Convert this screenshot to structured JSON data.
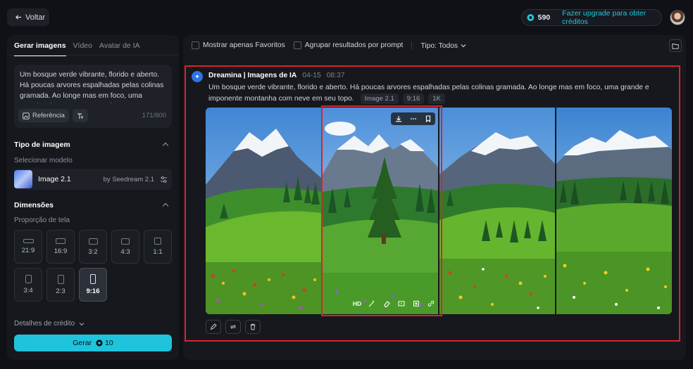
{
  "topbar": {
    "back_label": "Voltar",
    "credits": "590",
    "upgrade_label": "Fazer upgrade para obter créditos"
  },
  "left": {
    "tabs": [
      {
        "label": "Gerar imagens",
        "active": true
      },
      {
        "label": "Vídeo",
        "active": false
      },
      {
        "label": "Avatar de IA",
        "active": false
      }
    ],
    "prompt": "Um bosque verde vibrante, florido e aberto. Há poucas arvores espalhadas pelas colinas gramada. Ao longe mas em foco, uma grande e imponente montanha com neve em seu topo.",
    "reference_label": "Referência",
    "char_count": "171/800",
    "image_type_title": "Tipo de imagem",
    "select_model_label": "Selecionar modelo",
    "model_name": "Image 2.1",
    "model_by": "by Seedream 2.1",
    "dimensions_title": "Dimensões",
    "aspect_label": "Proporção de tela",
    "ratios": [
      "21:9",
      "16:9",
      "3:2",
      "4:3",
      "1:1",
      "3:4",
      "2:3",
      "9:16"
    ],
    "selected_ratio": "9:16",
    "credit_details_label": "Detalhes de crédito",
    "generate_label": "Gerar",
    "generate_cost": "10"
  },
  "right": {
    "filter_favorites": "Mostrar apenas Favoritos",
    "filter_group": "Agrupar resultados por prompt",
    "type_filter": "Tipo: Todos",
    "generation": {
      "source": "Dreamina | Imagens de IA",
      "date": "04-15",
      "time": "08:37",
      "prompt": "Um bosque verde vibrante, florido e aberto. Há poucas arvores espalhadas pelas colinas gramada. Ao longe mas em foco, uma grande e imponente montanha com neve em seu topo.",
      "tags": [
        "Image 2.1",
        "9:16",
        "1K"
      ],
      "hd_label": "HD"
    }
  },
  "colors": {
    "accent": "#1fc3dc",
    "highlight": "#d9232c",
    "background": "#0f1116",
    "panel": "#16181d"
  }
}
